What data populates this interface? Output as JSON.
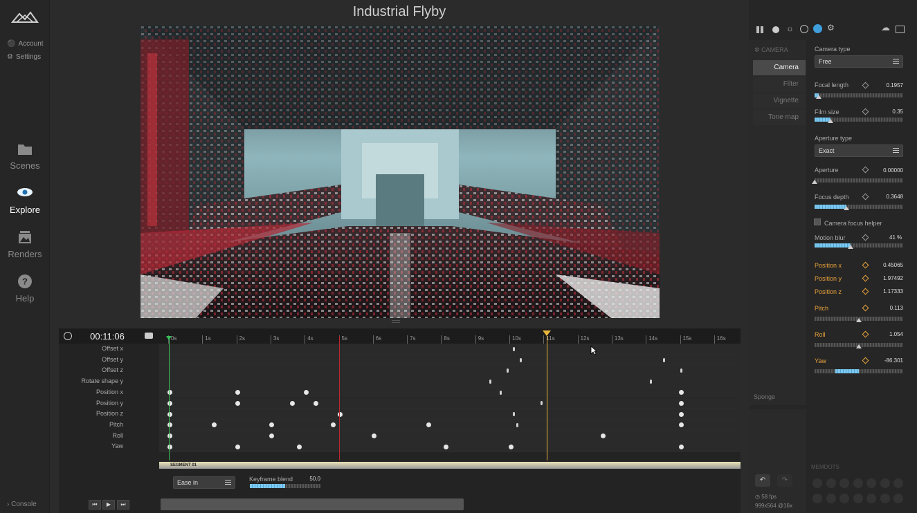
{
  "app": {
    "title": "Industrial Flyby"
  },
  "sidebar": {
    "account_label": "Account",
    "settings_label": "Settings",
    "items": [
      {
        "label": "Scenes",
        "icon": "folder-icon"
      },
      {
        "label": "Explore",
        "icon": "eye-icon",
        "active": true
      },
      {
        "label": "Renders",
        "icon": "image-stack-icon"
      },
      {
        "label": "Help",
        "icon": "help-icon"
      }
    ],
    "console_label": "Console"
  },
  "timeline": {
    "time": "00:11:06",
    "ticks": [
      "0s",
      "1s",
      "2s",
      "3s",
      "4s",
      "5s",
      "6s",
      "7s",
      "8s",
      "9s",
      "10s",
      "11s",
      "12s",
      "13s",
      "14s",
      "15s",
      "16s"
    ],
    "tracks": [
      "Offset x",
      "Offset y",
      "Offset z",
      "Rotate shape y",
      "Position x",
      "Position y",
      "Position z",
      "Pitch",
      "Roll",
      "Yaw"
    ],
    "playhead_seconds": 11.1,
    "marker_seconds": 5.0,
    "segment_label": "SEGMENT 01",
    "easing_value": "Ease in",
    "keyframe_blend_label": "Keyframe blend",
    "keyframe_blend_value": "50.0",
    "keyframe_blend_fraction": 0.5
  },
  "panel": {
    "section_title": "CAMERA",
    "categories": [
      "Camera",
      "Filter",
      "Vignette",
      "Tone map"
    ],
    "camera_type_label": "Camera type",
    "camera_type_value": "Free",
    "focal_length": {
      "label": "Focal length",
      "value": "0.1957",
      "fraction": 0.05
    },
    "film_size": {
      "label": "Film size",
      "value": "0.35",
      "fraction": 0.18
    },
    "aperture_type_label": "Aperture type",
    "aperture_type_value": "Exact",
    "aperture": {
      "label": "Aperture",
      "value": "0.00000",
      "fraction": 0.0
    },
    "focus_depth": {
      "label": "Focus depth",
      "value": "0.3648",
      "fraction": 0.36
    },
    "camera_focus_helper": "Camera focus helper",
    "motion_blur": {
      "label": "Motion blur",
      "value": "41",
      "unit": "%",
      "fraction": 0.41
    },
    "position_x": {
      "label": "Position x",
      "value": "0.45065"
    },
    "position_y": {
      "label": "Position y",
      "value": "1.97492"
    },
    "position_z": {
      "label": "Position z",
      "value": "1.17333"
    },
    "pitch": {
      "label": "Pitch",
      "value": "0.113"
    },
    "roll": {
      "label": "Roll",
      "value": "1.054"
    },
    "yaw": {
      "label": "Yaw",
      "value": "-86.301"
    },
    "sponge_label": "Sponge",
    "memdots_label": "MEMDOTS",
    "fps": "58 fps",
    "resolution": "999x564 @16x"
  },
  "colors": {
    "accent": "#4ea6d9",
    "keyframe_orange": "#e8a13a",
    "playhead": "#e8b73a",
    "start_marker": "#3bbf5a",
    "marker_red": "#c0282d"
  }
}
